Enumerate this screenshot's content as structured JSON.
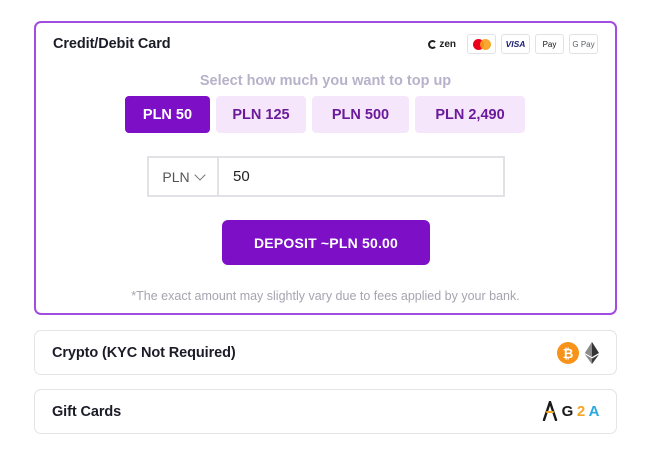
{
  "selected_method": {
    "title": "Credit/Debit Card",
    "logos": {
      "zen": "zen",
      "visa": "VISA",
      "apple_pay": " Pay",
      "google_pay": "G Pay"
    },
    "subtitle": "Select how much you want to top up",
    "amounts": [
      {
        "label": "PLN 50",
        "active": true
      },
      {
        "label": "PLN 125",
        "active": false
      },
      {
        "label": "PLN 500",
        "active": false
      },
      {
        "label": "PLN 2,490",
        "active": false
      }
    ],
    "currency": "PLN",
    "amount_value": "50",
    "deposit_label": "DEPOSIT ~PLN 50.00",
    "note": "*The exact amount may slightly vary due to fees applied by your bank."
  },
  "crypto": {
    "title": "Crypto (KYC Not Required)",
    "icons": [
      "bitcoin-icon",
      "ethereum-icon"
    ],
    "btc_symbol": "₿"
  },
  "gift_cards": {
    "title": "Gift Cards",
    "g2a": {
      "g": "G",
      "two": "2",
      "a": "A"
    }
  },
  "colors": {
    "accent": "#7d0fc7",
    "border_selected": "#a24ce0",
    "chip_bg": "#f6e6fb"
  }
}
